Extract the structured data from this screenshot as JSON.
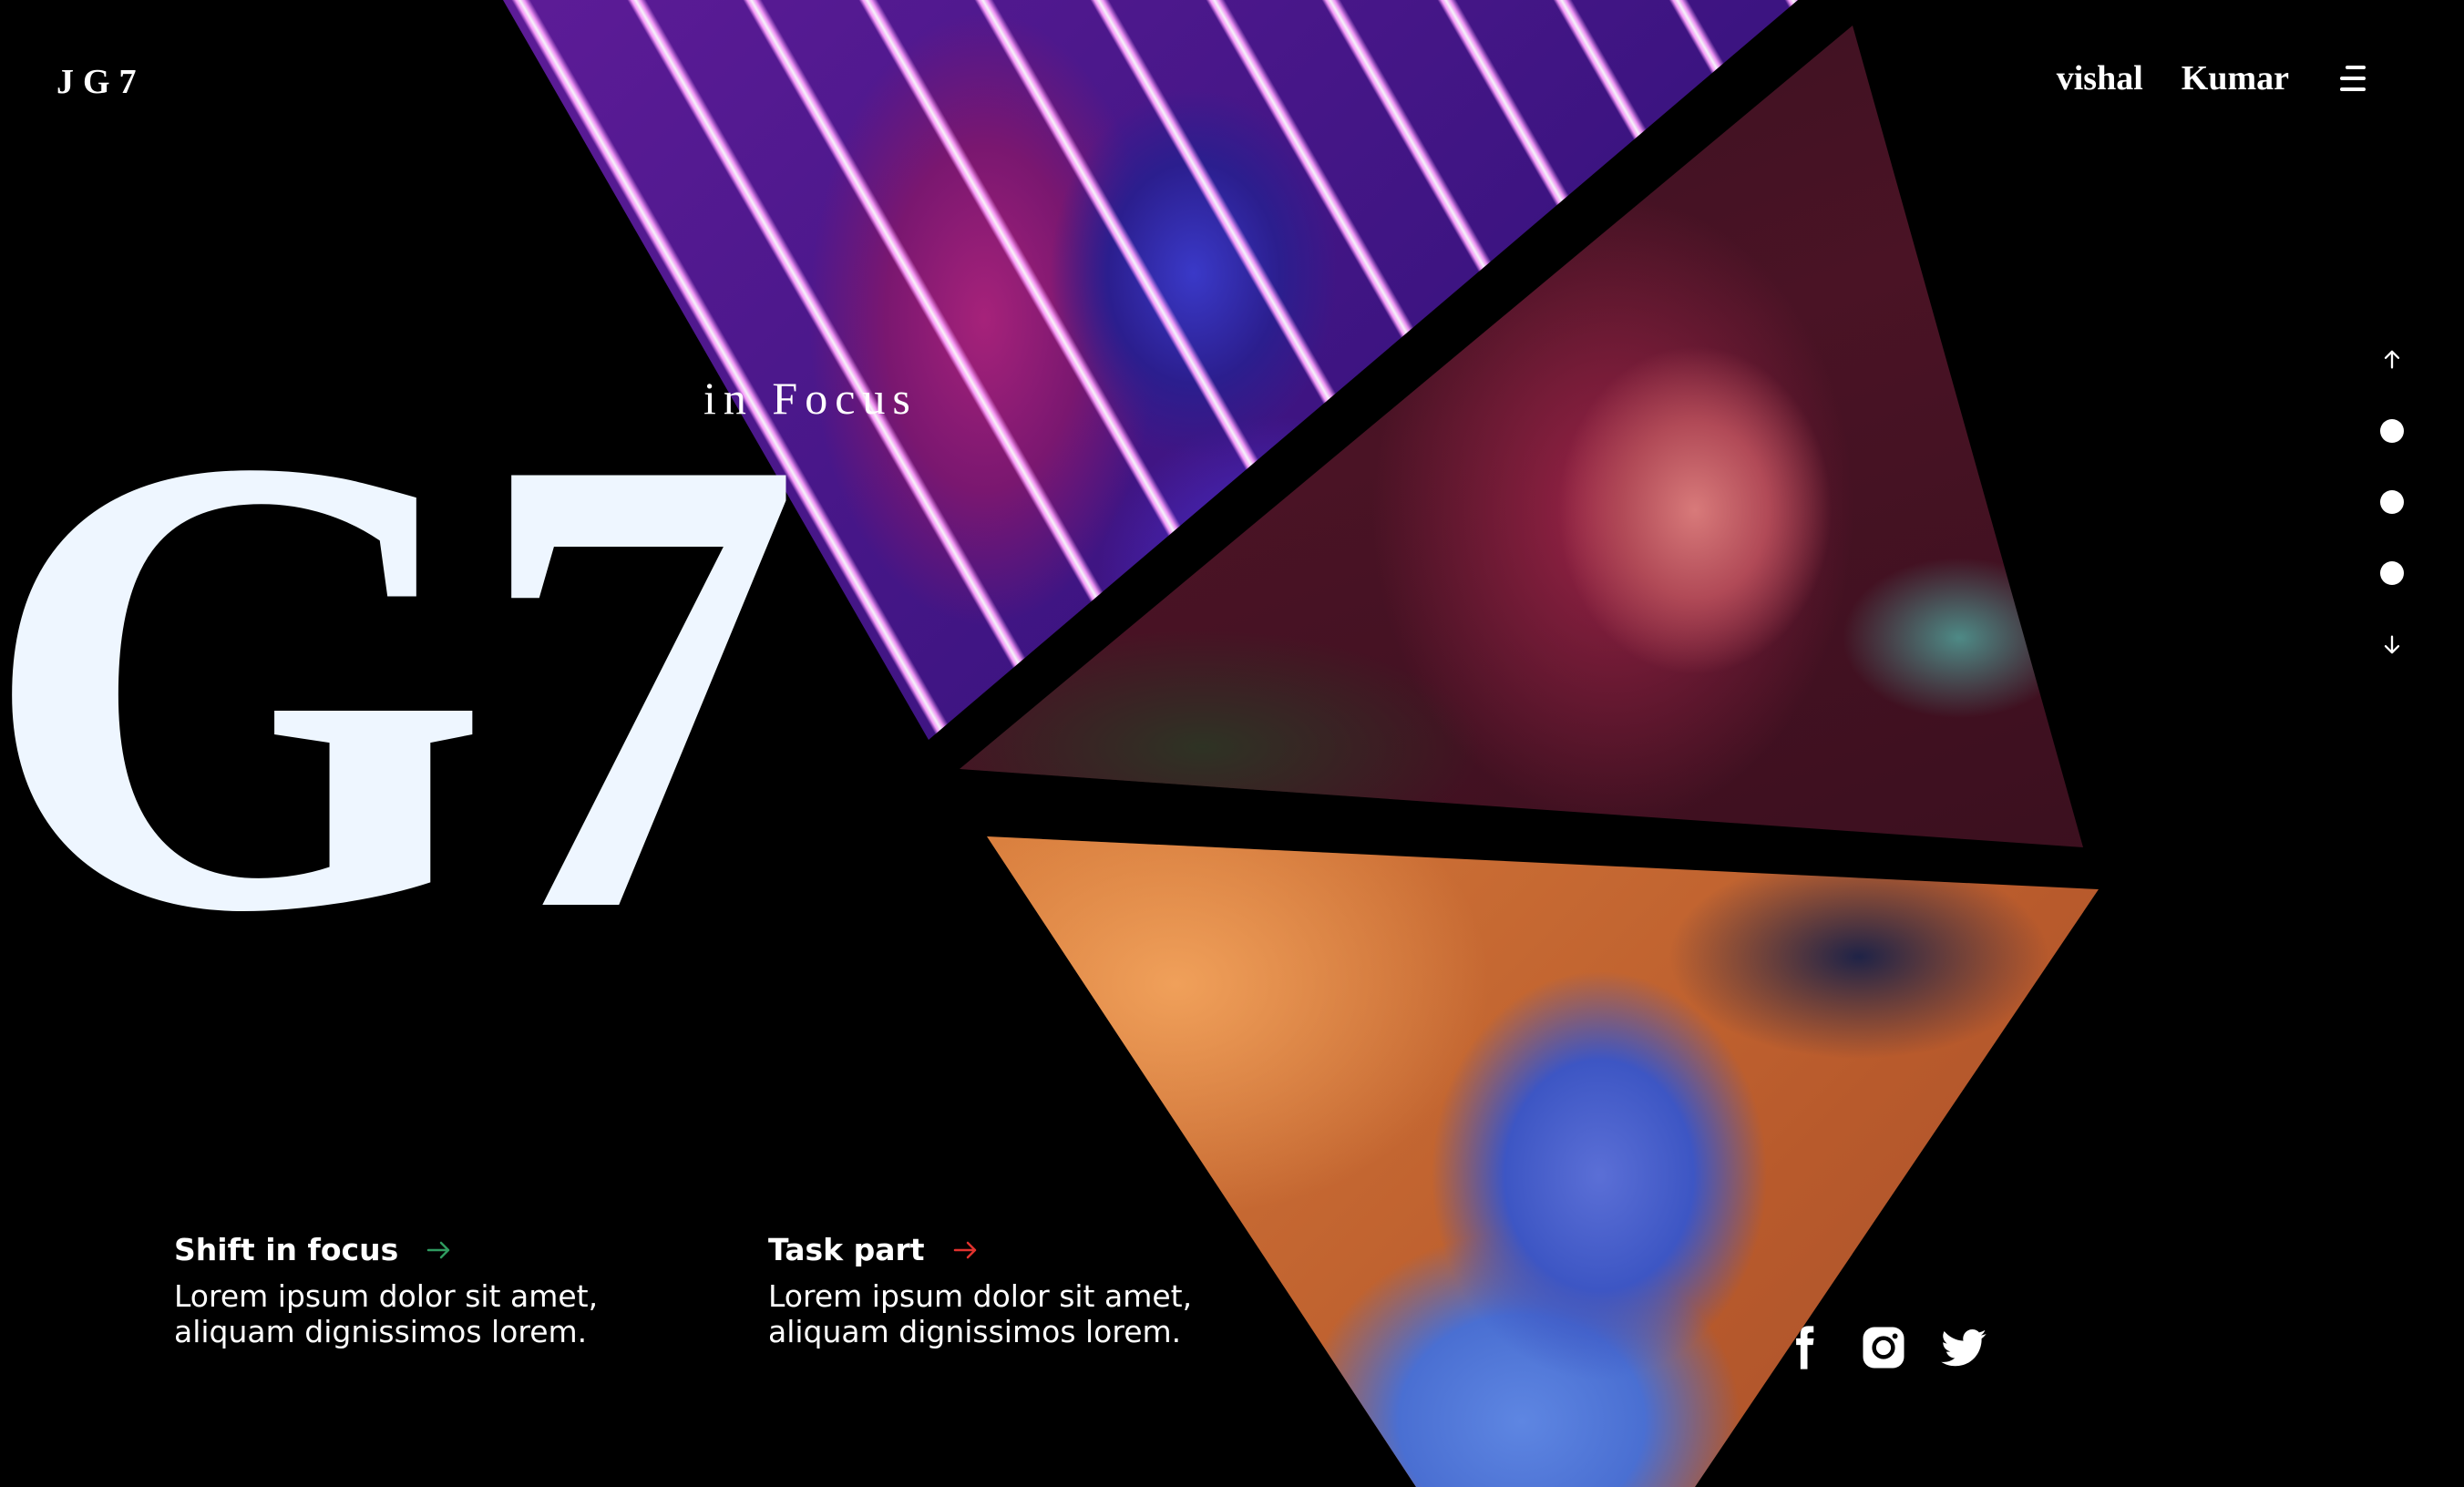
{
  "brand": "JG7",
  "hero": {
    "big_text": "G7",
    "subtitle": "in Focus"
  },
  "nav": {
    "items": [
      "vishal",
      "Kumar"
    ]
  },
  "features": [
    {
      "title": "Shift in focus",
      "text": "Lorem ipsum dolor sit amet, aliquam dignissimos lorem.",
      "arrow_color": "#2f9a5f"
    },
    {
      "title": "Task part",
      "text": "Lorem ipsum dolor sit amet, aliquam dignissimos lorem.",
      "arrow_color": "#e0322e"
    }
  ],
  "pager": {
    "dots": 3,
    "active": 0
  },
  "social": [
    "facebook-icon",
    "instagram-icon",
    "twitter-icon"
  ],
  "colors": {
    "background": "#000000",
    "text": "#ffffff",
    "hero_text": "#eef6ff"
  }
}
